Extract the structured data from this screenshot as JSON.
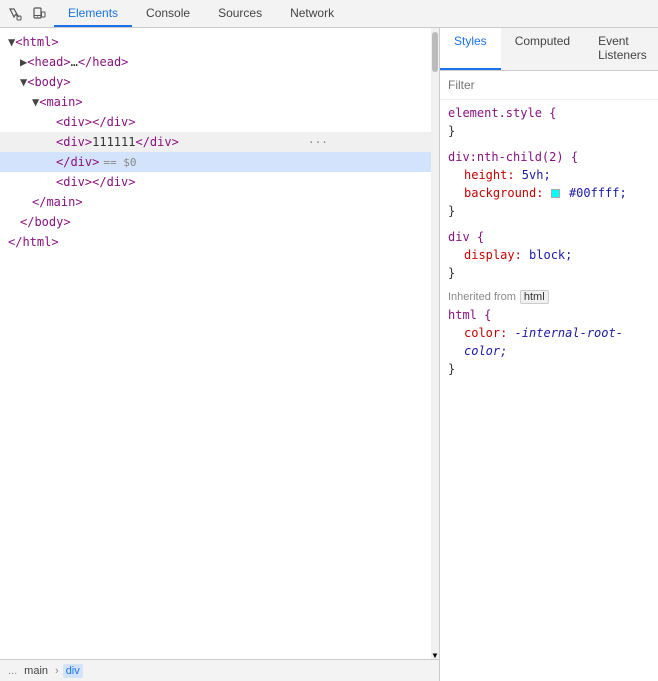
{
  "tabs": {
    "items": [
      {
        "label": "Elements",
        "active": true
      },
      {
        "label": "Console",
        "active": false
      },
      {
        "label": "Sources",
        "active": false
      },
      {
        "label": "Network",
        "active": false
      }
    ]
  },
  "toolbar": {
    "inspect_icon": "⬜",
    "device_icon": "📱"
  },
  "dom": {
    "lines": [
      {
        "indent": 0,
        "content": "<html>",
        "type": "tag"
      },
      {
        "indent": 1,
        "content": "<head>…</head>",
        "type": "collapsed"
      },
      {
        "indent": 1,
        "content": "<body>",
        "type": "tag"
      },
      {
        "indent": 2,
        "content": "<main>",
        "type": "tag"
      },
      {
        "indent": 3,
        "content": "<div></div>",
        "type": "self"
      },
      {
        "indent": 3,
        "content": "<div>111111</div>",
        "type": "selected",
        "has_dots": true
      },
      {
        "indent": 3,
        "content": "<div> == $0",
        "type": "highlighted"
      },
      {
        "indent": 3,
        "content": "<div></div>",
        "type": "self2"
      },
      {
        "indent": 2,
        "content": "</main>",
        "type": "close"
      },
      {
        "indent": 1,
        "content": "</body>",
        "type": "close"
      },
      {
        "indent": 0,
        "content": "</html>",
        "type": "close"
      }
    ]
  },
  "breadcrumbs": {
    "dots": "...",
    "items": [
      {
        "label": "main",
        "active": false
      },
      {
        "label": "div",
        "active": true
      }
    ]
  },
  "styles": {
    "subtabs": [
      {
        "label": "Styles",
        "active": true
      },
      {
        "label": "Computed",
        "active": false
      },
      {
        "label": "Event Listeners",
        "active": false
      }
    ],
    "filter_placeholder": "Filter",
    "rules": [
      {
        "selector": "element.style {",
        "close": "}",
        "props": []
      },
      {
        "selector": "div:nth-child(2) {",
        "close": "}",
        "props": [
          {
            "name": "height:",
            "value": "5vh;"
          },
          {
            "name": "background:",
            "value": "#00ffff;",
            "has_swatch": true
          }
        ]
      },
      {
        "selector": "div {",
        "close": "}",
        "props": [
          {
            "name": "display:",
            "value": "block;"
          }
        ]
      }
    ],
    "inherited": {
      "label": "Inherited from",
      "tag": "html",
      "rules": [
        {
          "selector": "html {",
          "close": "}",
          "props": [
            {
              "name": "color:",
              "value": "-internal-root-color;",
              "italic": true
            }
          ]
        }
      ]
    }
  }
}
